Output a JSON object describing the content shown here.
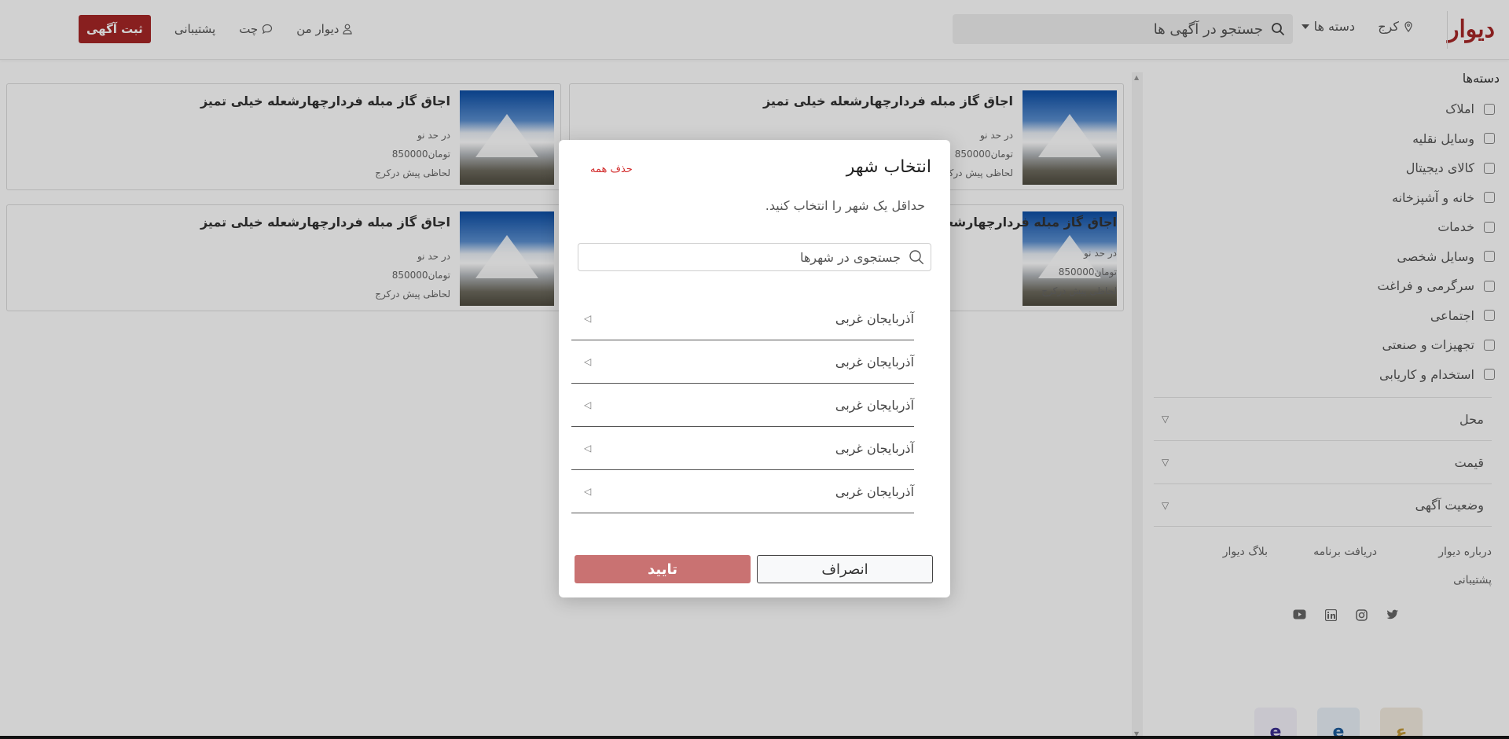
{
  "header": {
    "logo": "دیوار",
    "city": "کرج",
    "categories_label": "دسته ها",
    "search_placeholder": "جستجو در آگهی ها",
    "my_divar": "دیوار من",
    "chat": "چت",
    "support": "پشتیبانی",
    "post_ad": "ثبت آگهی"
  },
  "sidebar": {
    "title": "دسته‌ها",
    "categories": [
      {
        "label": "املاک",
        "icon": "building-icon"
      },
      {
        "label": "وسایل نقلیه",
        "icon": "car-icon"
      },
      {
        "label": "کالای دیجیتال",
        "icon": "phone-icon"
      },
      {
        "label": "خانه و آشپزخانه",
        "icon": "lamp-icon"
      },
      {
        "label": "خدمات",
        "icon": "pen-icon"
      },
      {
        "label": "وسایل شخصی",
        "icon": "watch-icon"
      },
      {
        "label": "سرگرمی و فراغت",
        "icon": "game-icon"
      },
      {
        "label": "اجتماعی",
        "icon": "people-icon"
      },
      {
        "label": "تجهیزات و صنعتی",
        "icon": "chair-icon"
      },
      {
        "label": "استخدام و کاریابی",
        "icon": "briefcase-icon"
      }
    ],
    "filters": [
      "محل",
      "قیمت",
      "وضعیت آگهی"
    ],
    "footer_links": [
      "درباره دیوار",
      "دریافت برنامه",
      "بلاگ دیوار",
      "پشتیبانی"
    ],
    "socials": [
      "twitter-icon",
      "instagram-icon",
      "linkedin-icon",
      "youtube-icon"
    ]
  },
  "listings": [
    {
      "title": "اجاق گاز مبله فردارچهارشعله خیلی تمیز",
      "condition": "در حد نو",
      "price": "تومان850000",
      "time": "لحاظی پیش درکرج"
    },
    {
      "title": "اجاق گاز مبله فردارچهارشعله خیلی تمیز",
      "condition": "در حد نو",
      "price": "تومان850000",
      "time": "لحاظی پیش درکرج"
    },
    {
      "title": "اجاق گاز مبله فردارچهارشعله خیلی تمیز",
      "condition": "در حد نو",
      "price": "تومان850000",
      "time": "لحاظی پیش درکرج"
    },
    {
      "title": "اجاق گاز مبله فردارچهارشعله خیلی",
      "condition": "در حد نو",
      "price": "تومان850000",
      "time": "لحاظی پیش درکرج"
    }
  ],
  "modal": {
    "title": "انتخاب شهر",
    "clear_all": "حذف همه",
    "hint": "حداقل یک شهر را انتخاب کنید.",
    "search_placeholder": "جستجوی در شهرها",
    "provinces": [
      "آذربایجان غربی",
      "آذربایجان غربی",
      "آذربایجان غربی",
      "آذربایجان غربی",
      "آذربایجان غربی"
    ],
    "cancel": "انصراف",
    "confirm": "تایید"
  },
  "colors": {
    "brand": "#a62626",
    "danger": "#d32f2f",
    "confirm_disabled": "#c97272"
  }
}
